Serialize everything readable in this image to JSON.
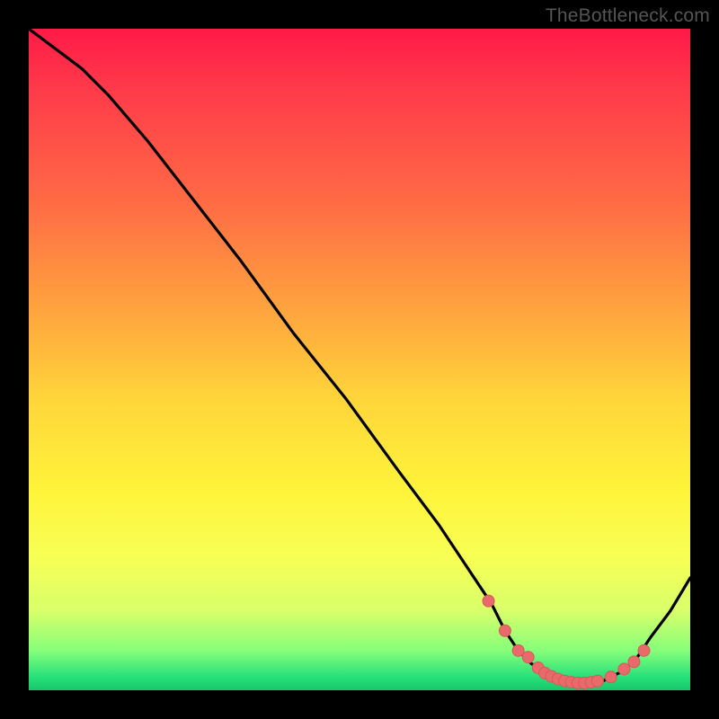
{
  "attribution": "TheBottleneck.com",
  "colors": {
    "gradient_top": "#ff1a47",
    "gradient_mid_upper": "#ff8a3f",
    "gradient_mid": "#ffe63a",
    "gradient_lower": "#c8ff60",
    "gradient_bottom": "#18c76a",
    "line": "#000000",
    "marker_fill": "#e86a6a",
    "marker_stroke": "#d85858",
    "frame": "#000000"
  },
  "chart_data": {
    "type": "line",
    "title": "",
    "xlabel": "",
    "ylabel": "",
    "xlim": [
      0,
      100
    ],
    "ylim": [
      0,
      100
    ],
    "grid": false,
    "legend": false,
    "series": [
      {
        "name": "curve",
        "x": [
          0,
          4,
          8,
          12,
          18,
          25,
          32,
          40,
          48,
          56,
          62,
          66,
          70,
          72,
          74,
          76,
          78,
          80,
          82,
          84,
          86,
          88,
          90,
          92,
          94,
          97,
          100
        ],
        "y": [
          100,
          97,
          94,
          90,
          83,
          74,
          65,
          54,
          44,
          33,
          25,
          19,
          13,
          9,
          6,
          4,
          3,
          2,
          1,
          1,
          1,
          2,
          3,
          5,
          8,
          12,
          17
        ]
      }
    ],
    "markers": {
      "name": "valley-points",
      "x": [
        69.5,
        72,
        74,
        75.5,
        77,
        78,
        79,
        80,
        81,
        82,
        83,
        84,
        85,
        86,
        88,
        90,
        91.5,
        93
      ],
      "y": [
        13.5,
        9,
        6,
        5,
        3.4,
        2.6,
        2.1,
        1.7,
        1.4,
        1.2,
        1.1,
        1.1,
        1.2,
        1.4,
        2,
        3.2,
        4.3,
        6
      ]
    }
  }
}
